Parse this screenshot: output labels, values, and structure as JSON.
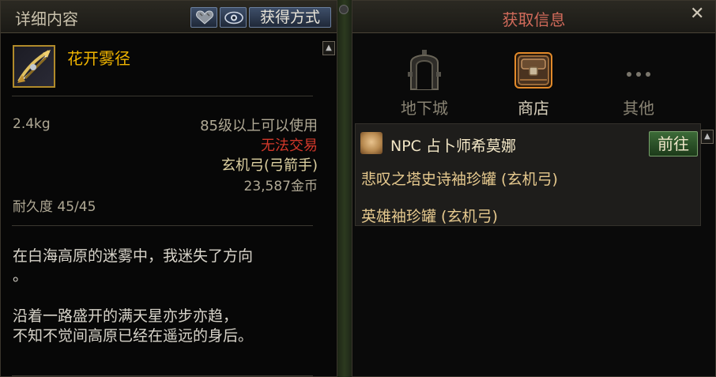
{
  "left_panel": {
    "title": "详细内容",
    "acquire_button": "获得方式",
    "item": {
      "name": "花开雾径",
      "weight": "2.4kg",
      "level_requirement": "85级以上可以使用",
      "trade_status": "无法交易",
      "weapon_type": "玄机弓(弓箭手)",
      "price": "23,587金币",
      "durability": "耐久度 45/45"
    },
    "description": {
      "line1": "在白海高原的迷雾中，我迷失了方向",
      "line2": "。",
      "line3": "沿着一路盛开的满天星亦步亦趋，",
      "line4": "不知不觉间高原已经在遥远的身后。"
    },
    "icons": {
      "heart": "heart-icon",
      "eye": "eye-icon",
      "item": "bow-weapon-icon"
    },
    "colors": {
      "item_name": "#f0b400",
      "untradeable": "#d2382a",
      "weapon_type": "#ddd0a0"
    }
  },
  "right_panel": {
    "title": "获取信息",
    "close_label": "✕",
    "categories": [
      {
        "label": "地下城",
        "icon": "dungeon-gate-icon",
        "selected": false
      },
      {
        "label": "商店",
        "icon": "shop-chest-icon",
        "selected": true
      },
      {
        "label": "其他",
        "icon": "more-dots-icon",
        "selected": false
      }
    ],
    "source": {
      "npc": "NPC 占卜师希莫娜",
      "goto_button": "前往",
      "items": [
        "悲叹之塔史诗袖珍罐 (玄机弓)",
        "英雄袖珍罐 (玄机弓)"
      ]
    },
    "colors": {
      "title": "#d06a5a",
      "goto_button": "#3c6a38"
    }
  }
}
